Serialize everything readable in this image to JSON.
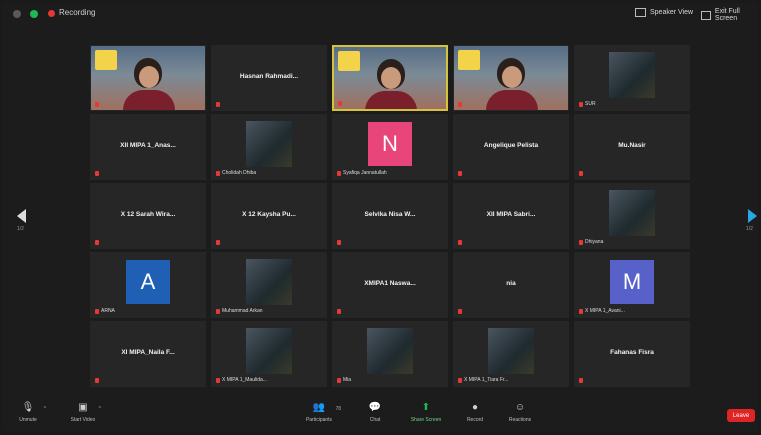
{
  "topbar": {
    "recording_label": "Recording",
    "speaker_view": "Speaker View",
    "fullscreen": "Exit Full Screen"
  },
  "grid": {
    "tiles": [
      {
        "type": "video",
        "tag": ""
      },
      {
        "type": "name",
        "name": "Hasnan Rahmadi...",
        "tag": ""
      },
      {
        "type": "video",
        "active": true,
        "tag": ""
      },
      {
        "type": "video",
        "tag": ""
      },
      {
        "type": "photo",
        "tag": "SUR"
      },
      {
        "type": "name",
        "name": "XII MIPA 1_Anas...",
        "tag": ""
      },
      {
        "type": "photo",
        "tag": "Cholidah Dhiba"
      },
      {
        "type": "avatar",
        "letter": "N",
        "color": "#e8467a",
        "tag": "Syafiqa Jannatullah"
      },
      {
        "type": "name",
        "name": "Angelique Pelista",
        "tag": ""
      },
      {
        "type": "name",
        "name": "Mu.Nasir",
        "tag": ""
      },
      {
        "type": "name",
        "name": "X 12 Sarah Wira...",
        "tag": ""
      },
      {
        "type": "name",
        "name": "X 12 Kaysha Pu...",
        "tag": ""
      },
      {
        "type": "name",
        "name": "Selvika Nisa W...",
        "tag": ""
      },
      {
        "type": "name",
        "name": "XII MIPA Sabri...",
        "tag": ""
      },
      {
        "type": "photo",
        "tag": "Dhiyana"
      },
      {
        "type": "avatar",
        "letter": "A",
        "color": "#1f5fb4",
        "tag": "ARNA"
      },
      {
        "type": "photo",
        "tag": "Muhammad Arkan"
      },
      {
        "type": "name",
        "name": "XMIPA1 Naswa...",
        "tag": ""
      },
      {
        "type": "name",
        "name": "nia",
        "tag": ""
      },
      {
        "type": "avatar",
        "letter": "M",
        "color": "#5860c9",
        "tag": "X MIPA 1_Avani..."
      },
      {
        "type": "name",
        "name": "XI MIPA_Naila F...",
        "tag": ""
      },
      {
        "type": "photo",
        "tag": "X MIPA 1_Maulida..."
      },
      {
        "type": "photo",
        "tag": "Mia"
      },
      {
        "type": "photo",
        "tag": "X MIPA 1_Tiara Fr..."
      },
      {
        "type": "name",
        "name": "Fahanas Fisra",
        "tag": ""
      }
    ]
  },
  "pager": {
    "left": "1/2",
    "right": "1/2"
  },
  "toolbar": {
    "unmute": "Unmute",
    "start_video": "Start Video",
    "participants": "Participants",
    "participants_count": "78",
    "chat": "Chat",
    "share_screen": "Share Screen",
    "record": "Record",
    "reactions": "Reactions",
    "end": "Leave"
  },
  "colors": {
    "active_border": "#d4c43a",
    "share_green": "#1db954",
    "end_red": "#e02424"
  }
}
